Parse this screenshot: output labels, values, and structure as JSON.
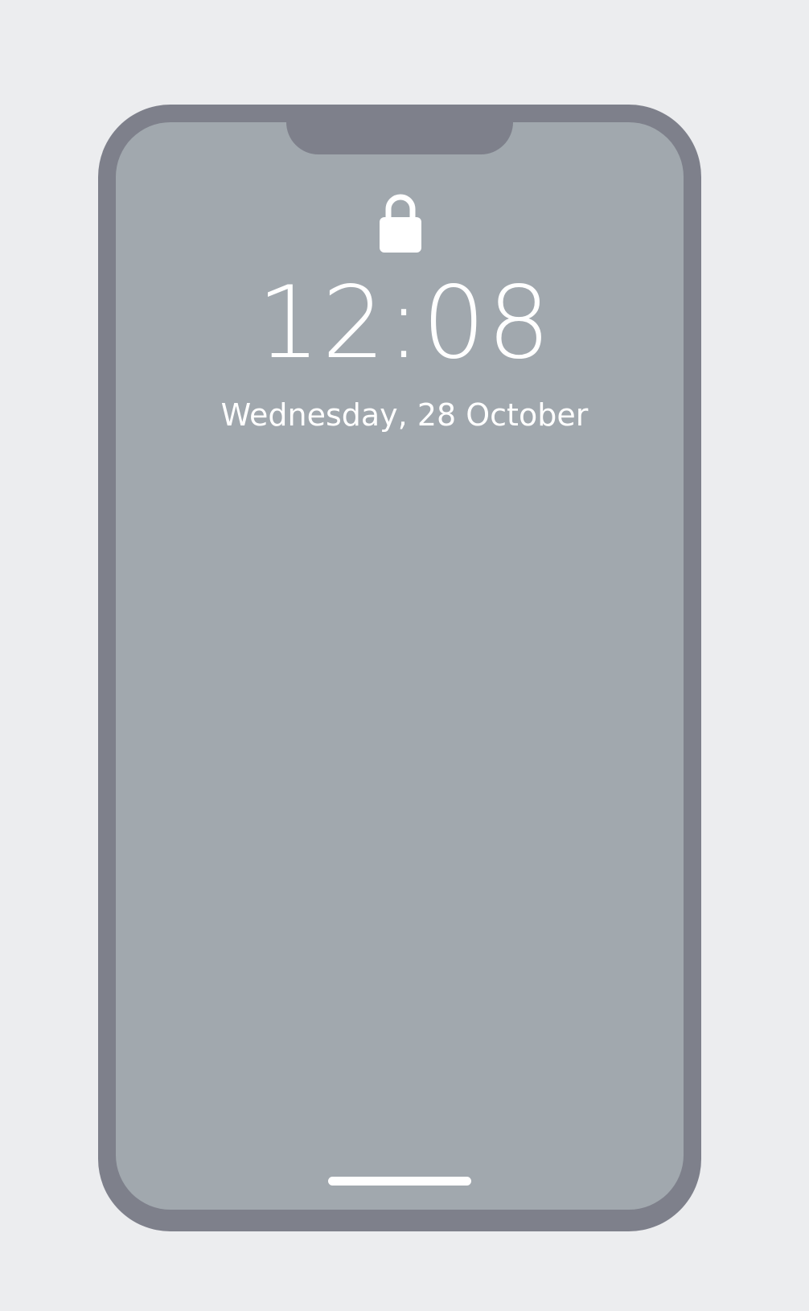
{
  "lock_screen": {
    "time": "12:08",
    "date": "Wednesday, 28 October",
    "lock_icon": "lock-icon"
  },
  "colors": {
    "page_background": "#ecedef",
    "frame": "#7e808b",
    "screen": "#a1a8ae",
    "foreground": "#ffffff"
  }
}
